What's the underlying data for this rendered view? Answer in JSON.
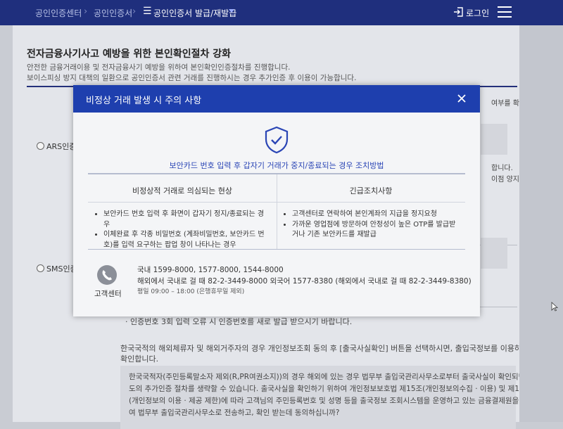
{
  "nav": {
    "breadcrumb": [
      "공인인증센터",
      "공인인증서",
      "공인인증서 발급/재발급"
    ],
    "login_label": "로그인"
  },
  "page": {
    "title": "전자금융사기사고 예방을 위한 본인확인절차 강화",
    "desc": [
      "안전한 금융거래이용 및 전자금융사기 예방을 위하여 본인확인인증절차를 진행합니다.",
      "보이스피싱 방지 대책의 일환으로 공인인증서 관련 거래를 진행하시는 경우 추가인증 후 이용이 가능합니다."
    ],
    "options": [
      "ARS인증",
      "SMS인증"
    ],
    "right_fragments": [
      "여부를 확",
      "합니다.",
      "이점 양지"
    ],
    "bullet": "인증번호 3회 입력 오류 시 인증번호를 새로 발급 받으시기 바랍니다.",
    "paragraph": [
      "한국국적의 해외체류자 및 해외거주자의 경우 개인정보조회 동의 후 [출국사실확인] 버튼을 선택하시면, 출입국정보를 이용하여 본인여부를",
      "확인합니다."
    ],
    "box_lines": [
      "한국국적자(주민등록말소자 제외(R,PR여권소지))의 경우 해외에 있는 경우 법무부 출입국관리사무소로부터 출국사실이 확인되면 별",
      "도의 추가인증 절차를 생략할 수 있습니다. 출국사실을 확인하기 위하여 개인정보보호법 제15조(개인정보의수집 · 이용) 및 제18조",
      "(개인정보의 이용 · 제공 제한)에 따라 고객님의 주민등록번호 및 성명 등을 출국정보 조회시스템을 운영하고 있는 금융결제원을 통하",
      "여 법무부 출입국관리사무소로 전송하고, 확인 받는데 동의하십니까?"
    ]
  },
  "modal": {
    "title": "비정상 거래 발생 시 주의 사항",
    "subtitle": "보안카드 번호 입력 후 갑자기 거래가 중지/종료되는 경우 조치방법",
    "columns": [
      "비정상적 거래로 의심되는 현상",
      "긴급조치사항"
    ],
    "symptoms": [
      "보안카드 번호 입력 후 화면이 갑자기 정지/종료되는 경우",
      "이체완료 후 각종 비밀번호 (계좌비밀번호, 보안카드 번호)를 입력 요구하는 팝업 창이 나타나는 경우"
    ],
    "actions": [
      "고객센터로 연락하여 본인계좌의 지급을 정지요청",
      "가까운 영업점에 방문하여 안정성이 높은 OTP를 발급받거나 기존 보안카드를 재발급"
    ],
    "support_label": "고객센터",
    "support_lines": [
      "국내 1599-8000, 1577-8000, 1544-8000",
      "해외에서 국내로 걸 때 82-2-3449-8000   외국어 1577-8380 (해외에서 국내로 걸 때 82-2-3449-8380)"
    ],
    "support_hours": "평일 09:00 – 18:00 (은행휴무일 제외)"
  },
  "colors": {
    "nav_bg": "#1f2f7d",
    "modal_header": "#1e3fae",
    "accent_text": "#2a45b5"
  }
}
